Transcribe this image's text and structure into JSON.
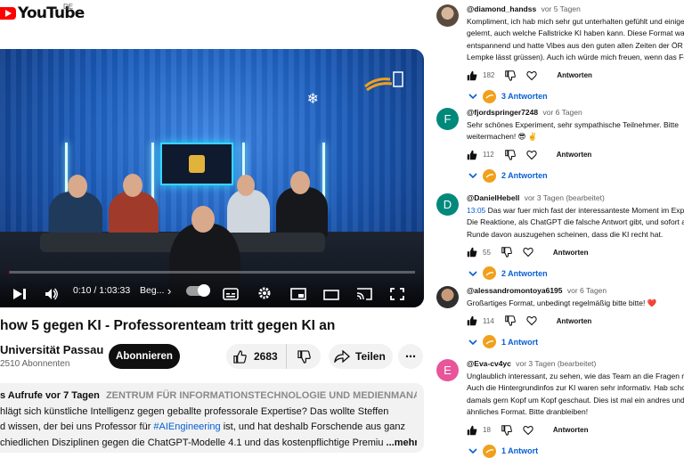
{
  "header": {
    "logo_text": "YouTube",
    "country": "DE"
  },
  "player": {
    "time": "0:10 / 1:03:33",
    "chapter": "Beg...",
    "chevron": "›",
    "progress": 0.003
  },
  "video": {
    "title": "how 5 gegen KI - Professorenteam tritt gegen KI an",
    "channel": "Universität Passau",
    "subscribers": "2510 Abonnenten",
    "subscribe_label": "Abonnieren",
    "likes": "2683",
    "share_label": "Teilen",
    "more_glyph": "⋯"
  },
  "description": {
    "views": "s Aufrufe",
    "date": "vor 7 Tagen",
    "tag": "ZENTRUM FÜR INFORMATIONSTECHNOLOGIE UND MEDIENMANAGEME",
    "line1": "hlägt sich künstliche Intelligenz gegen geballte professorale Expertise? Das wollte Steffen",
    "line2_pre": "d wissen, der bei uns Professor für ",
    "hashtag": "#AIEngineering",
    "line2_post": " ist, und hat deshalb Forschende aus ganz",
    "line3": "chiedlichen Disziplinen gegen die ChatGPT-Modelle 4.1 und das kostenpflichtige Premiu",
    "more": " ...mehr"
  },
  "comments": [
    {
      "author": "@diamond_handss",
      "time": "vor 5 Tagen",
      "avatar_letter": "",
      "lines": [
        "Kompliment, ich hab mich sehr gut unterhalten gefühlt und einiges",
        "gelernt, auch welche Fallstricke KI haben kann. Diese Format war",
        "entspannend und hatte Vibes aus den guten allen Zeiten der ÖR (R",
        "Lempke lässt grüssen). Auch ich würde mich freuen, wenn das Fo"
      ],
      "likes": "182",
      "reply": "Antworten",
      "replies": "3 Antworten"
    },
    {
      "author": "@fjordspringer7248",
      "time": "vor 6 Tagen",
      "avatar_letter": "F",
      "lines": [
        "Sehr schönes Experiment, sehr sympathische Teilnehmer. Bitte",
        "weitermachen! 😎 ✌️"
      ],
      "likes": "112",
      "reply": "Antworten",
      "replies": "2 Antworten"
    },
    {
      "author": "@DanielHebell",
      "time": "vor 3 Tagen (bearbeitet)",
      "avatar_letter": "D",
      "timestamp": "13:05",
      "lines": [
        " Das war fuer mich fast der interessanteste Moment im Expe",
        "Die Reaktione, als ChatGPT die falsche Antwort gibt, und sofort al",
        "Runde davon auszugehen scheinen, dass die KI recht hat."
      ],
      "likes": "55",
      "reply": "Antworten",
      "replies": "2 Antworten"
    },
    {
      "author": "@alessandromontoya6195",
      "time": "vor 6 Tagen",
      "avatar_letter": "",
      "lines": [
        "Großartiges Format, unbedingt regelmäßig bitte bitte! ❤️"
      ],
      "likes": "114",
      "reply": "Antworten",
      "replies": "1 Antwort"
    },
    {
      "author": "@Eva-cv4yc",
      "time": "vor 3 Tagen (bearbeitet)",
      "avatar_letter": "E",
      "lines": [
        "Unglaublich interessant, zu sehen, wie das Team an die Fragen ra",
        "Auch die Hintergrundinfos zur KI waren sehr informativ. Hab scho",
        "damals gern Kopf um Kopf geschaut. Dies ist mal ein andres und",
        "ähnliches Format. Bitte dranbleiben!"
      ],
      "likes": "18",
      "reply": "Antworten",
      "replies": "1 Antwort"
    }
  ],
  "colors": {
    "accent": "#065fd4",
    "brand": "#ff0000",
    "avatar_f": "#00897b",
    "avatar_d": "#00897b",
    "avatar_e": "#e8559a",
    "badge": "#f0a01c"
  }
}
